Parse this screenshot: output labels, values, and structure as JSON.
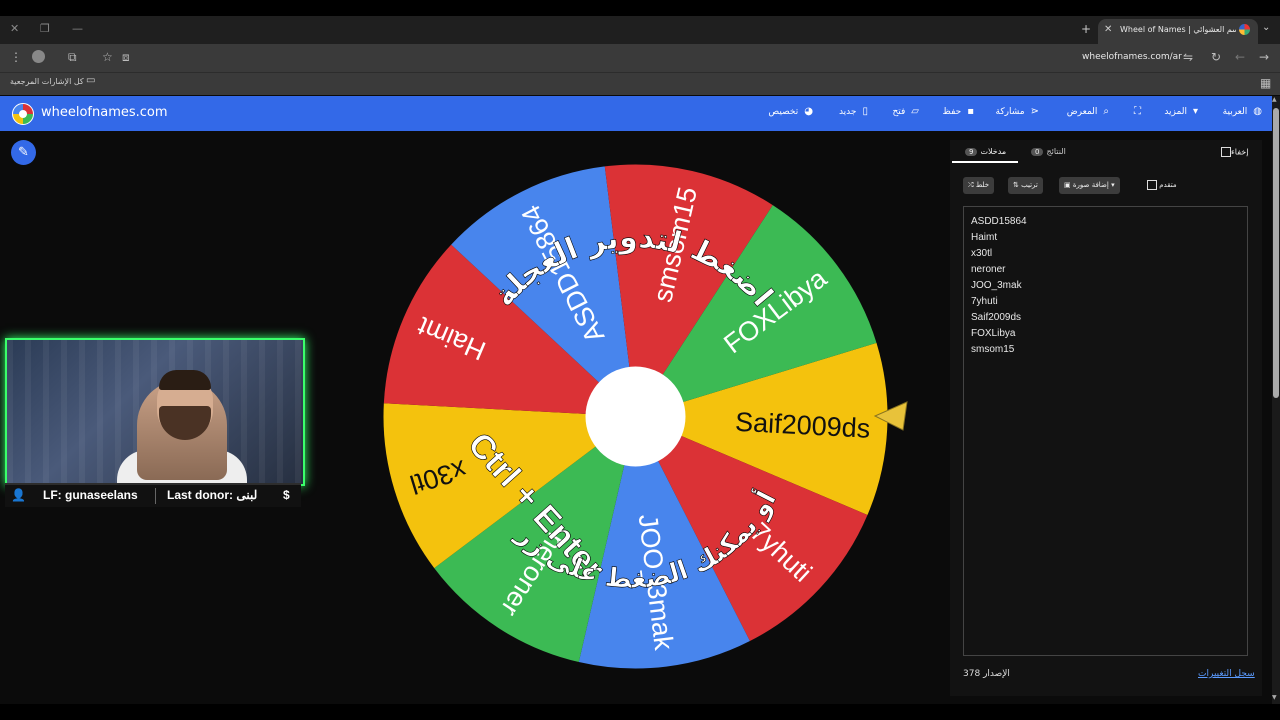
{
  "browser": {
    "tab_title": "Wheel of Names | اسم العشوائي",
    "url": "wheelofnames.com/ar",
    "bookmarks_label": "كل الإشارات المرجعية"
  },
  "site": {
    "title": "wheelofnames.com",
    "menu": {
      "language": "العربية",
      "more": "المزيد",
      "gallery": "المعرض",
      "share": "مشاركة",
      "save": "حفظ",
      "open": "فتح",
      "new": "جديد",
      "customize": "تخصيص"
    }
  },
  "stream": {
    "lf_text": "LF: gunaseelans",
    "donor_text": "Last donor: لبنى"
  },
  "wheel": {
    "segments": [
      {
        "label": "Saif2009ds",
        "color": "#f4c20d"
      },
      {
        "label": "7yhuti",
        "color": "#db3236"
      },
      {
        "label": "JOO_3mak",
        "color": "#4885ed"
      },
      {
        "label": "neroner",
        "color": "#3cba54"
      },
      {
        "label": "x30tl",
        "color": "#f4c20d"
      },
      {
        "label": "Haimt",
        "color": "#db3236"
      },
      {
        "label": "ASDD15864",
        "color": "#4885ed"
      },
      {
        "label": "smsom15",
        "color": "#db3236"
      },
      {
        "label": "FOXLibya",
        "color": "#3cba54"
      }
    ],
    "overlay_top": "اضغط لتدوير العجلة",
    "overlay_ctrl": "Ctrl + Enter",
    "overlay_bottom": "أو يمكنك الضغط على زر"
  },
  "panel": {
    "entries_tab": "مدخلات",
    "entries_count": "9",
    "results_tab": "النتائج",
    "results_count": "0",
    "hide_label": "إخفاء",
    "shuffle_label": "خلط",
    "sort_label": "ترتيب",
    "add_image_label": "إضافة صورة",
    "advanced_label": "متقدم",
    "entries": [
      "ASDD15864",
      "Haimt",
      "x30tl",
      "neroner",
      "JOO_3mak",
      "7yhuti",
      "Saif2009ds",
      "FOXLibya",
      "smsom15"
    ],
    "version_label": "الإصدار",
    "version_number": "378",
    "changelog_label": "سجل التغييرات"
  }
}
